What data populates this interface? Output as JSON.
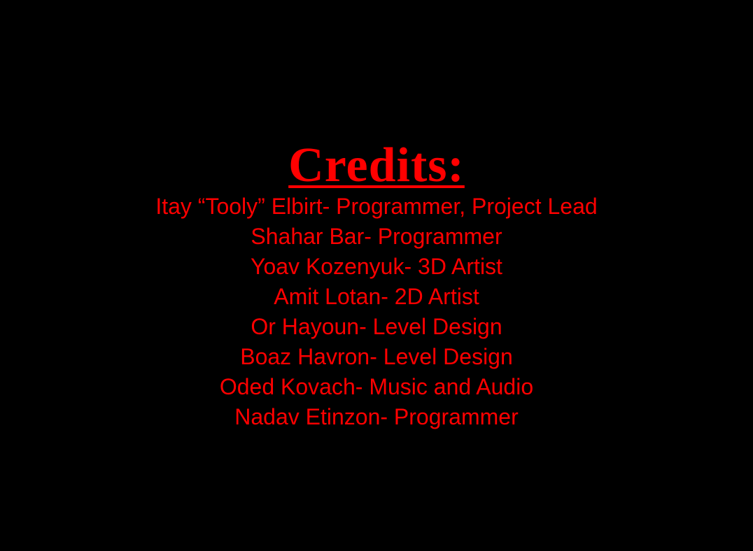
{
  "colors": {
    "background": "#000000",
    "text": "#ff0000"
  },
  "credits": {
    "title": "Credits:",
    "lines": [
      "Itay “Tooly” Elbirt- Programmer, Project Lead",
      "Shahar Bar- Programmer",
      "Yoav Kozenyuk- 3D Artist",
      "Amit Lotan- 2D Artist",
      "Or Hayoun- Level Design",
      "Boaz Havron- Level Design",
      "Oded Kovach- Music and Audio",
      "Nadav Etinzon- Programmer"
    ]
  }
}
